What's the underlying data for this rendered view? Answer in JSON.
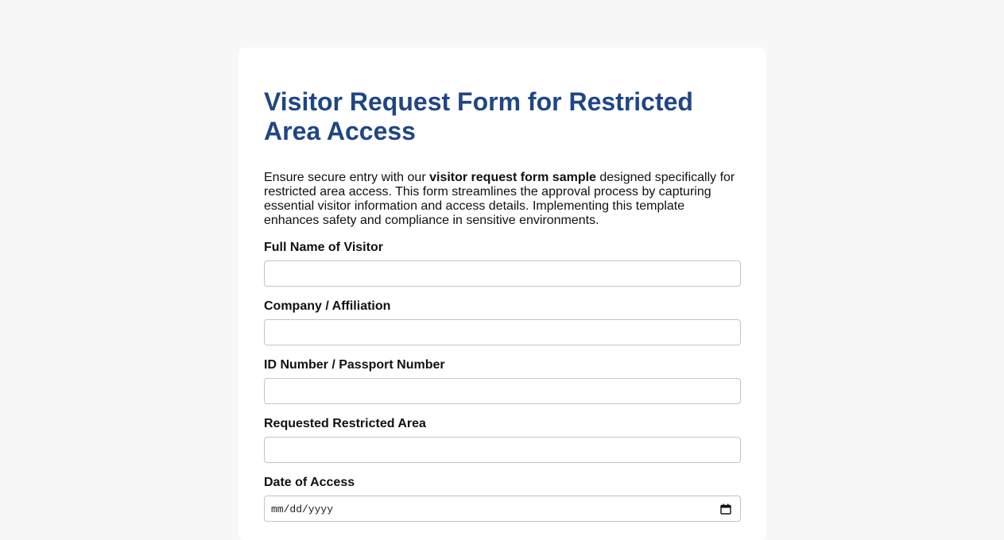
{
  "form": {
    "title": "Visitor Request Form for Restricted Area Access",
    "intro": {
      "before": "Ensure secure entry with our ",
      "bold": "visitor request form sample",
      "after": " designed specifically for restricted area access. This form streamlines the approval process by capturing essential visitor information and access details. Implementing this template enhances safety and compliance in sensitive environments."
    },
    "fields": {
      "full_name": {
        "label": "Full Name of Visitor",
        "value": ""
      },
      "company": {
        "label": "Company / Affiliation",
        "value": ""
      },
      "id_number": {
        "label": "ID Number / Passport Number",
        "value": ""
      },
      "area": {
        "label": "Requested Restricted Area",
        "value": ""
      },
      "date": {
        "label": "Date of Access",
        "placeholder": "mm/dd/yyyy"
      }
    }
  },
  "icons": {
    "date_picker": "calendar-icon"
  },
  "colors": {
    "title": "#1f4685",
    "background": "#f7f7f7",
    "card": "#ffffff"
  }
}
